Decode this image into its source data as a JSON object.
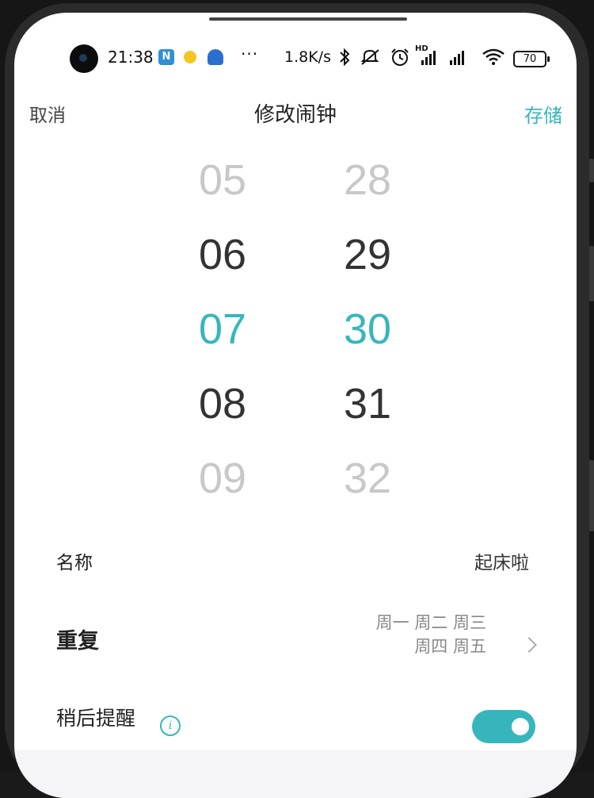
{
  "status_bar": {
    "time": "21:38",
    "app_icon_1": "N",
    "dots": "···",
    "net_speed": "1.8K/s",
    "hd_label": "HD",
    "battery": "70",
    "icons": [
      "bluetooth-icon",
      "mute-icon",
      "alarm-icon",
      "signal-icon",
      "wifi-icon",
      "battery-icon"
    ]
  },
  "header": {
    "cancel_label": "取消",
    "title": "修改闹钟",
    "save_label": "存储"
  },
  "picker": {
    "hours": [
      "05",
      "06",
      "07",
      "08",
      "09"
    ],
    "minutes": [
      "28",
      "29",
      "30",
      "31",
      "32"
    ],
    "selected_hour": "07",
    "selected_minute": "30"
  },
  "settings": {
    "name_label": "名称",
    "name_value": "起床啦",
    "repeat_label": "重复",
    "repeat_line1": "周一 周二 周三",
    "repeat_line2": "周四 周五",
    "snooze_label": "稍后提醒",
    "snooze_enabled": true
  },
  "colors": {
    "accent": "#36b6bc",
    "text_primary": "#222222",
    "text_secondary": "#888888",
    "picker_faded": "#c8c8c8"
  }
}
